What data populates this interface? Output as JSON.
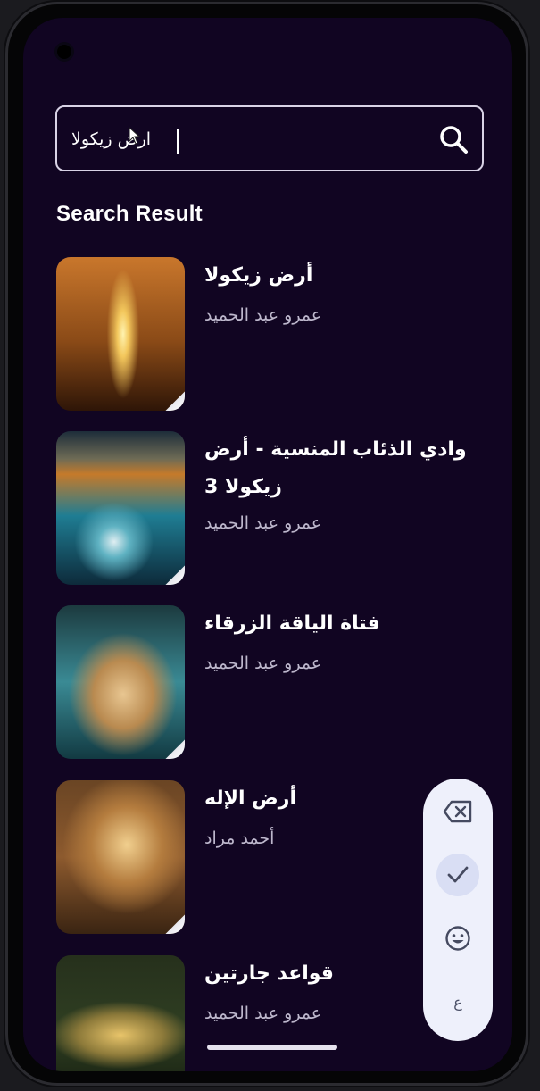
{
  "search": {
    "value": "ارض زيكولا",
    "placeholder": ""
  },
  "heading": "Search Result",
  "results": [
    {
      "title": "أرض زيكولا",
      "author": "عمرو عبد الحميد",
      "cover_colors": [
        "#f3c75c",
        "#8a4a17",
        "#2e1507"
      ]
    },
    {
      "title": "وادي الذئاب المنسية - أرض زيكولا 3",
      "author": "عمرو عبد الحميد",
      "cover_colors": [
        "#f0b343",
        "#1f7d93",
        "#0d2a3a"
      ]
    },
    {
      "title": "فتاة الياقة الزرقاء",
      "author": "عمرو عبد الحميد",
      "cover_colors": [
        "#d9b27a",
        "#3a8a94",
        "#123a42"
      ]
    },
    {
      "title": "أرض الإله",
      "author": "أحمد مراد",
      "cover_colors": [
        "#e6b468",
        "#8d5a2e",
        "#3a2412"
      ]
    },
    {
      "title": "قواعد جارتين",
      "author": "عمرو عبد الحميد",
      "cover_colors": [
        "#d8b05a",
        "#2f3f22",
        "#11180d"
      ]
    }
  ],
  "keyboard_tools": {
    "icons": [
      "backspace-icon",
      "check-icon",
      "emoji-icon",
      "language-icon"
    ],
    "language_label": "ع"
  },
  "colors": {
    "background": "#110522",
    "text": "#ffffff",
    "author_text": "#bdb7cc",
    "search_border": "#d9d3e6",
    "keyboard_pill": "#eef0fb"
  }
}
